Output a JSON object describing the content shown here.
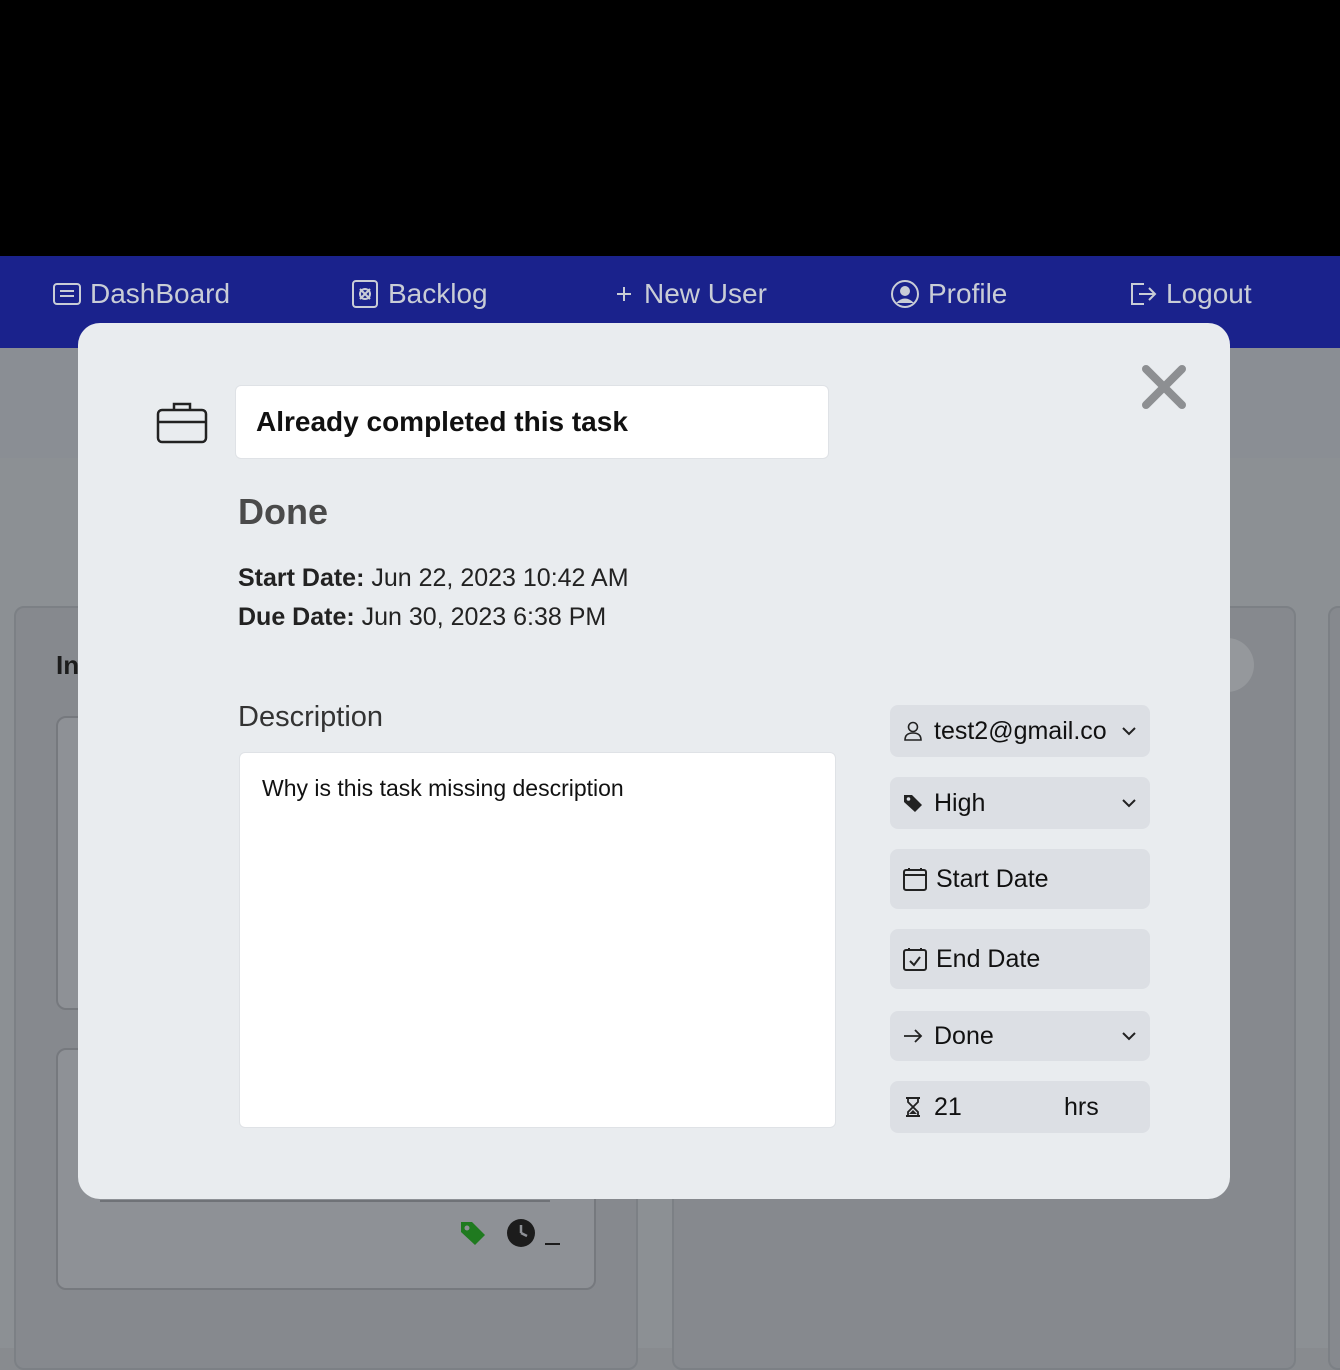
{
  "nav": {
    "dashboard": "DashBoard",
    "backlog": "Backlog",
    "new_user": "New User",
    "profile": "Profile",
    "logout": "Logout"
  },
  "board": {
    "column_title": "In"
  },
  "modal": {
    "title_value": "Already completed this task",
    "status_heading": "Done",
    "start_label": "Start Date:",
    "start_value": "Jun 22, 2023 10:42 AM",
    "due_label": "Due Date:",
    "due_value": "Jun 30, 2023 6:38 PM",
    "description_label": "Description",
    "description_value": "Why is this task missing description",
    "assignee": "test2@gmail.co",
    "priority": "High",
    "start_date_btn": "Start Date",
    "end_date_btn": "End Date",
    "status": "Done",
    "hours_value": "21",
    "hours_unit": "hrs"
  },
  "colors": {
    "navbar": "#1a228c",
    "tag_green": "#1f7a1f"
  }
}
